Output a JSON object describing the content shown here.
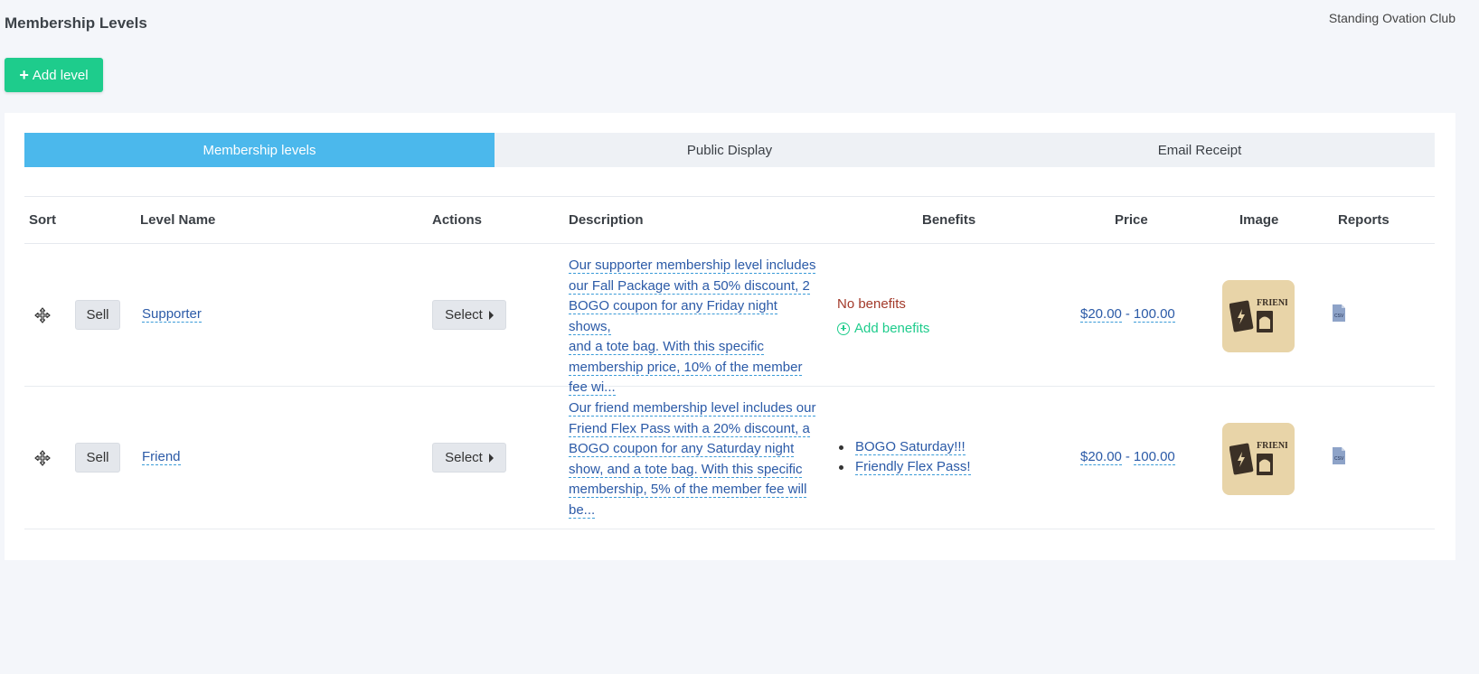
{
  "page": {
    "title": "Membership Levels",
    "org_name": "Standing Ovation Club",
    "add_level_label": "Add level",
    "brand_color": "#1ecc8c",
    "accent_color": "#4bb8ec"
  },
  "tabs": [
    {
      "label": "Membership levels",
      "active": true
    },
    {
      "label": "Public Display",
      "active": false
    },
    {
      "label": "Email Receipt",
      "active": false
    }
  ],
  "table": {
    "headers": {
      "sort": "Sort",
      "level_name": "Level Name",
      "actions": "Actions",
      "description": "Description",
      "benefits": "Benefits",
      "price": "Price",
      "image": "Image",
      "reports": "Reports"
    },
    "rows": [
      {
        "sell_label": "Sell",
        "name": "Supporter",
        "select_label": "Select",
        "description_lines": [
          "Our supporter membership level includes",
          "our Fall Package with a 50% discount, 2",
          "BOGO coupon for any Friday night shows,",
          "and a tote bag. With this specific",
          "membership price, 10% of the member",
          "fee wi..."
        ],
        "no_benefits_text": "No benefits",
        "add_benefits_label": "Add benefits",
        "benefits": [],
        "price_min": "$20.00",
        "price_max": "100.00",
        "image_label": "FRIEND",
        "report_icon": "csv-file-icon",
        "report_label": "CSV"
      },
      {
        "sell_label": "Sell",
        "name": "Friend",
        "select_label": "Select",
        "description_lines": [
          "Our friend membership level includes our",
          "Friend Flex Pass with a 20% discount, a",
          "BOGO coupon for any Saturday night",
          "show, and a tote bag. With this specific",
          "membership, 5% of the member fee will",
          "be..."
        ],
        "benefits": [
          "BOGO Saturday!!!",
          "Friendly Flex Pass!"
        ],
        "price_min": "$20.00",
        "price_max": "100.00",
        "image_label": "FRIEND",
        "report_icon": "csv-file-icon",
        "report_label": "CSV"
      }
    ]
  }
}
